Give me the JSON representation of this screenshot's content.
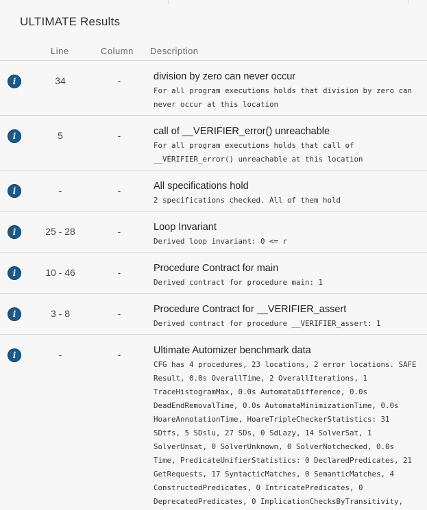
{
  "title": "ULTIMATE Results",
  "columns": {
    "line": "Line",
    "column": "Column",
    "description": "Description"
  },
  "rows": [
    {
      "line": "34",
      "column": "-",
      "title": "division by zero can never occur",
      "text": "For all program executions holds that division by zero can never occur at this location"
    },
    {
      "line": "5",
      "column": "-",
      "title": "call of __VERIFIER_error() unreachable",
      "text": "For all program executions holds that call of __VERIFIER_error() unreachable at this location"
    },
    {
      "line": "-",
      "column": "-",
      "title": "All specifications hold",
      "text": "2 specifications checked. All of them hold"
    },
    {
      "line": "25 - 28",
      "column": "-",
      "title": "Loop Invariant",
      "text": "Derived loop invariant: 0 <= r"
    },
    {
      "line": "10 - 46",
      "column": "-",
      "title": "Procedure Contract for main",
      "text": "Derived contract for procedure main: 1"
    },
    {
      "line": "3 - 8",
      "column": "-",
      "title": "Procedure Contract for __VERIFIER_assert",
      "text": "Derived contract for procedure __VERIFIER_assert: 1"
    },
    {
      "line": "-",
      "column": "-",
      "title": "Ultimate Automizer benchmark data",
      "text": "CFG has 4 procedures, 23 locations, 2 error locations. SAFE Result, 0.0s OverallTime, 2 OverallIterations, 1 TraceHistogramMax, 0.0s AutomataDifference, 0.0s DeadEndRemovalTime, 0.0s AutomataMinimizationTime, 0.0s HoareAnnotationTime, HoareTripleCheckerStatistics: 31 SDtfs, 5 SDslu, 27 SDs, 0 SdLazy, 14 SolverSat, 1 SolverUnsat, 0 SolverUnknown, 0 SolverNotchecked, 0.0s Time, PredicateUnifierStatistics: 0 DeclaredPredicates, 21 GetRequests, 17 SyntacticMatches, 0 SemanticMatches, 4 ConstructedPredicates, 0 IntricatePredicates, 0 DeprecatedPredicates, 0 ImplicationChecksByTransitivity,"
    }
  ],
  "icons": {
    "row_icon": "info-icon"
  },
  "colors": {
    "info": "#1a5a8a",
    "separator": "#d9d9d9",
    "background": "#f7f7f7"
  }
}
